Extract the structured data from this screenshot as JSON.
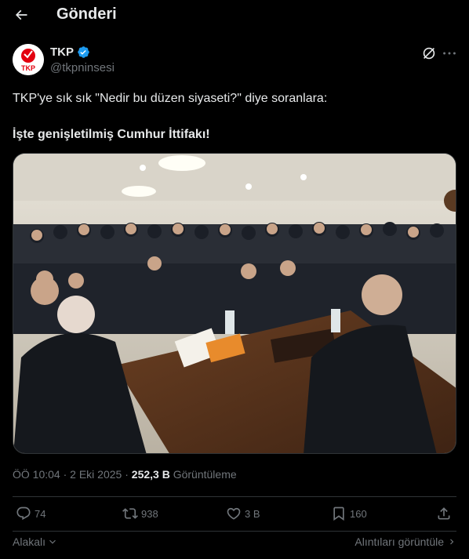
{
  "header": {
    "title": "Gönderi"
  },
  "author": {
    "name": "TKP",
    "handle": "@tkpninsesi",
    "avatar_text": "TKP"
  },
  "tweet": {
    "line1": "TKP'ye sık sık \"Nedir bu düzen siyaseti?\" diye soranlara:",
    "line2": "İşte genişletilmiş Cumhur İttifakı!"
  },
  "meta": {
    "time": "ÖÖ 10:04",
    "date": "2 Eki 2025",
    "views_count": "252,3 B",
    "views_label": "Görüntüleme"
  },
  "actions": {
    "replies": "74",
    "reposts": "938",
    "likes": "3 B",
    "bookmarks": "160"
  },
  "footer": {
    "related": "Alakalı",
    "quotes": "Alıntıları görüntüle"
  },
  "colors": {
    "background": "#000000",
    "text": "#e7e9ea",
    "muted": "#71767b",
    "verified": "#1d9bf0",
    "divider": "#2f3336",
    "logo_red": "#e3000f"
  },
  "icons": [
    "back-arrow-icon",
    "verified-badge-icon",
    "grok-icon",
    "more-icon",
    "reply-icon",
    "repost-icon",
    "like-icon",
    "bookmark-icon",
    "share-icon",
    "chevron-down-icon",
    "chevron-right-icon"
  ]
}
